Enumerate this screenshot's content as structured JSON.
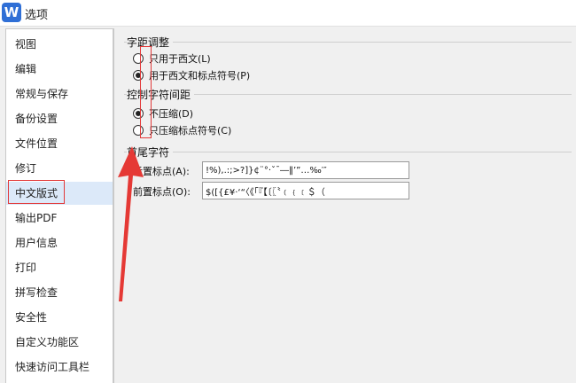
{
  "window": {
    "title": "选项",
    "icon_letter": "W",
    "accent": "#2f6fd6"
  },
  "sidebar": {
    "selected_index": 7,
    "items": [
      {
        "label": "视图"
      },
      {
        "label": "编辑"
      },
      {
        "label": "常规与保存"
      },
      {
        "label": "备份设置"
      },
      {
        "label": "文件位置"
      },
      {
        "label": "修订"
      },
      {
        "label": "中文版式"
      },
      {
        "label": "输出PDF"
      },
      {
        "label": "用户信息"
      },
      {
        "label": "打印"
      },
      {
        "label": "拼写检查"
      },
      {
        "label": "安全性"
      },
      {
        "label": "自定义功能区"
      },
      {
        "label": "快速访问工具栏"
      }
    ]
  },
  "spacing_group": {
    "title": "字距调整",
    "options": [
      {
        "label": "只用于西文(L)",
        "checked": false
      },
      {
        "label": "用于西文和标点符号(P)",
        "checked": true
      }
    ]
  },
  "char_spacing_group": {
    "title": "控制字符间距",
    "options": [
      {
        "label": "不压缩(D)",
        "checked": true
      },
      {
        "label": "只压缩标点符号(C)",
        "checked": false
      }
    ]
  },
  "line_break_group": {
    "title": "首尾字符",
    "following_label": "后置标点(A):",
    "following_value": "!%),.:;>?]}¢¨°·ˇˉ―‖’”…‰′″",
    "leading_label": "前置标点(O):",
    "leading_value": "$([{£¥·‘“〈《「『【〔〖〝﹙﹛﹝＄（"
  },
  "annotation_color": "#e23a3a"
}
